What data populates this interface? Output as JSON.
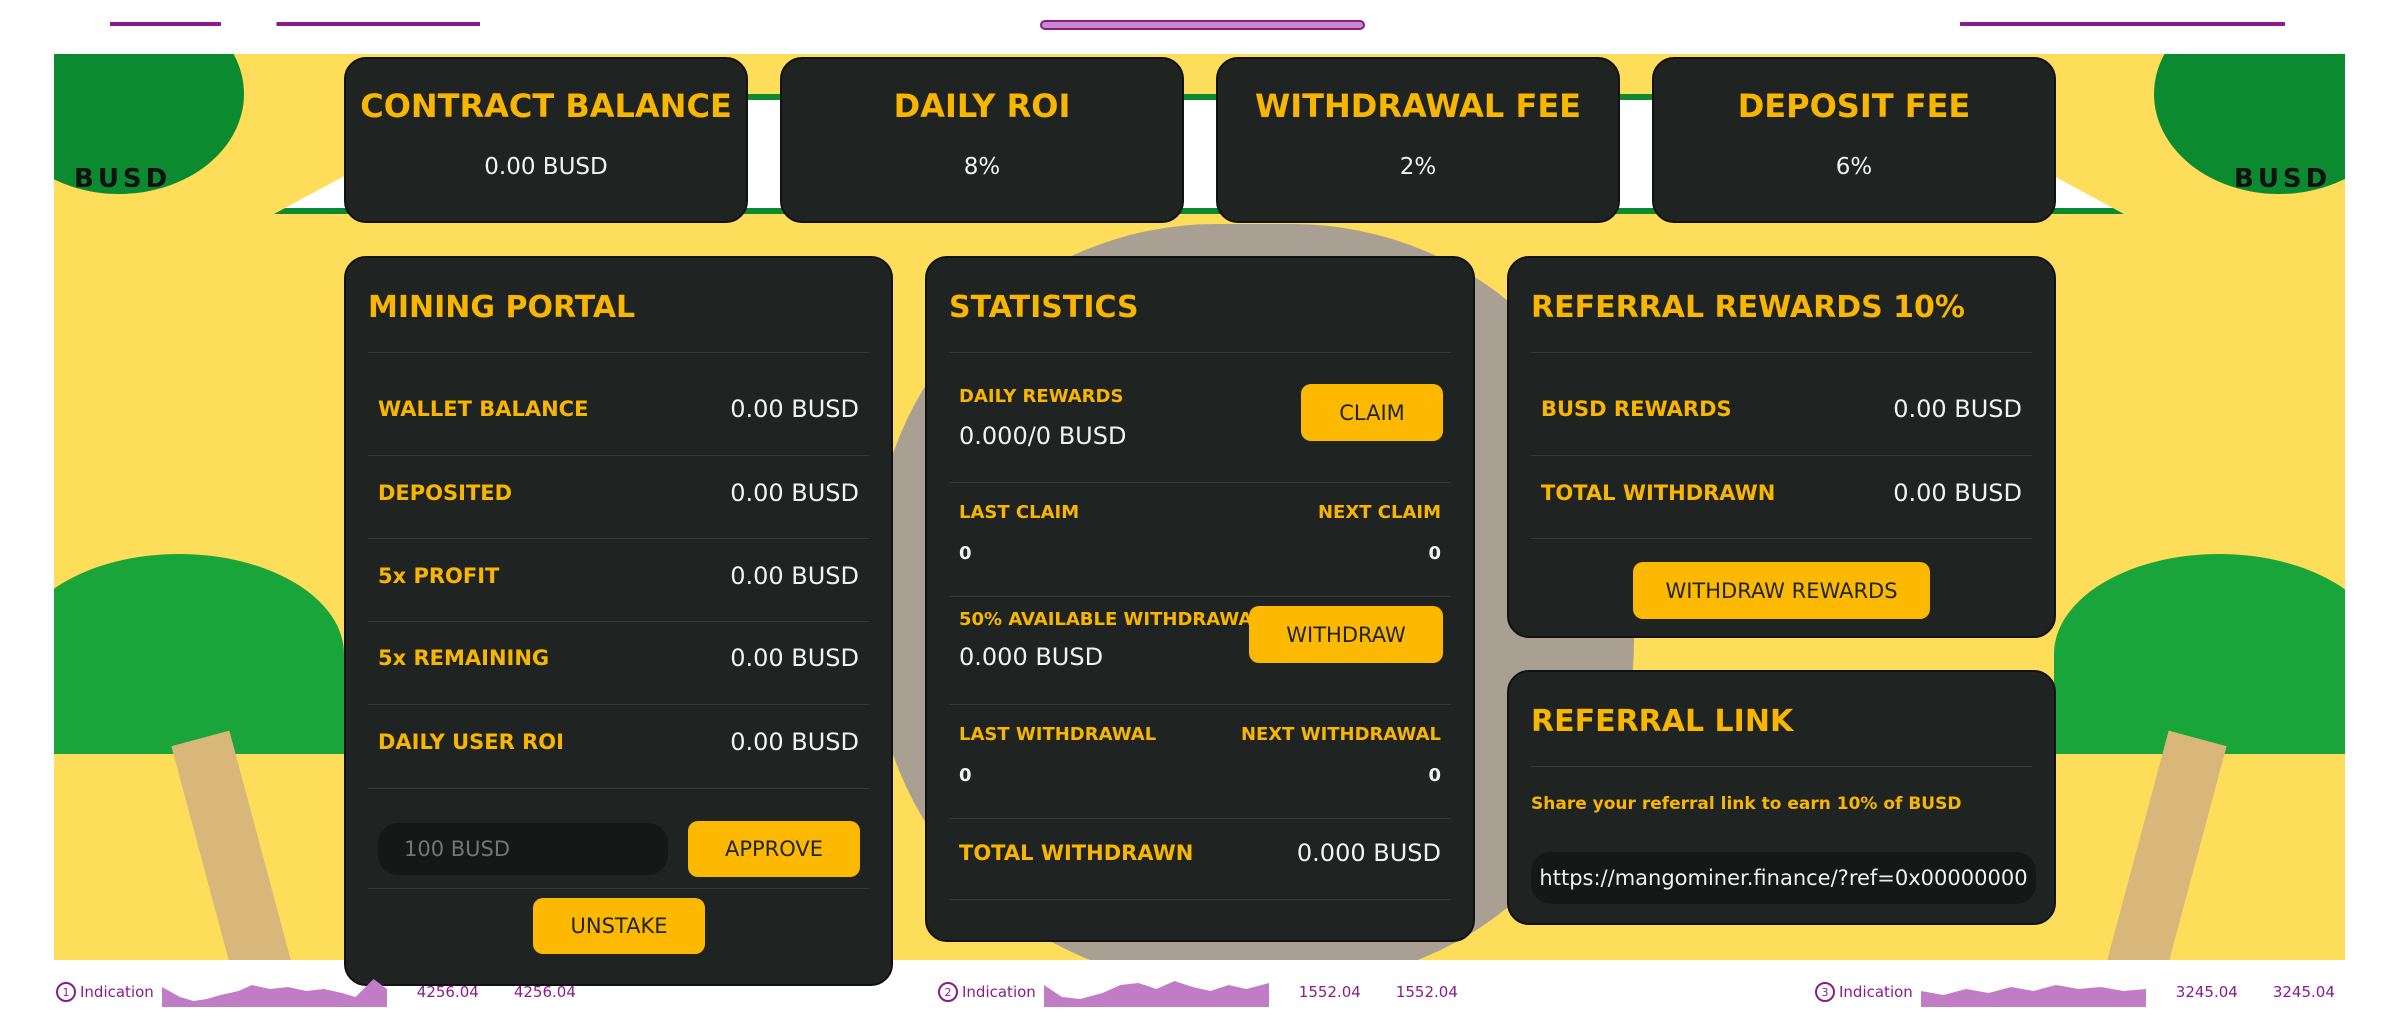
{
  "colors": {
    "accent": "#f8b600",
    "card": "#1f2423",
    "background": "#fedd5a",
    "footer": "#8a1b8f"
  },
  "stats": [
    {
      "title": "CONTRACT BALANCE",
      "value": "0.00 BUSD"
    },
    {
      "title": "DAILY ROI",
      "value": "8%"
    },
    {
      "title": "WITHDRAWAL FEE",
      "value": "2%"
    },
    {
      "title": "DEPOSIT FEE",
      "value": "6%"
    }
  ],
  "logo_text": "BUSD",
  "mining": {
    "title": "MINING PORTAL",
    "rows": [
      {
        "label": "WALLET BALANCE",
        "value": "0.00 BUSD"
      },
      {
        "label": "DEPOSITED",
        "value": "0.00 BUSD"
      },
      {
        "label": "5x PROFIT",
        "value": "0.00 BUSD"
      },
      {
        "label": "5x REMAINING",
        "value": "0.00 BUSD"
      },
      {
        "label": "DAILY USER ROI",
        "value": "0.00 BUSD"
      }
    ],
    "input_placeholder": "100 BUSD",
    "approve": "APPROVE",
    "unstake": "UNSTAKE"
  },
  "statistics": {
    "title": "STATISTICS",
    "daily_rewards_label": "DAILY REWARDS",
    "daily_rewards_value": "0.000/0 BUSD",
    "claim": "CLAIM",
    "last_claim_label": "LAST CLAIM",
    "last_claim_value": "0",
    "next_claim_label": "NEXT CLAIM",
    "next_claim_value": "0",
    "avail_label": "50% AVAILABLE WITHDRAWAL",
    "avail_value": "0.000 BUSD",
    "withdraw": "WITHDRAW",
    "last_withdrawal_label": "LAST WITHDRAWAL",
    "last_withdrawal_value": "0",
    "next_withdrawal_label": "NEXT WITHDRAWAL",
    "next_withdrawal_value": "0",
    "total_label": "TOTAL WITHDRAWN",
    "total_value": "0.000 BUSD"
  },
  "referral_rewards": {
    "title": "REFERRAL REWARDS 10%",
    "rows": [
      {
        "label": "BUSD REWARDS",
        "value": "0.00 BUSD"
      },
      {
        "label": "TOTAL WITHDRAWN",
        "value": "0.00 BUSD"
      }
    ],
    "button": "WITHDRAW REWARDS"
  },
  "referral_link": {
    "title": "REFERRAL LINK",
    "description": "Share your referral link to earn 10% of BUSD",
    "link": "https://mangominer.finance/?ref=0x00000000"
  },
  "footer": [
    {
      "num": "1",
      "label": "Indication",
      "v1": "4256.04",
      "v2": "4256.04"
    },
    {
      "num": "2",
      "label": "Indication",
      "v1": "1552.04",
      "v2": "1552.04"
    },
    {
      "num": "3",
      "label": "Indication",
      "v1": "3245.04",
      "v2": "3245.04"
    }
  ]
}
